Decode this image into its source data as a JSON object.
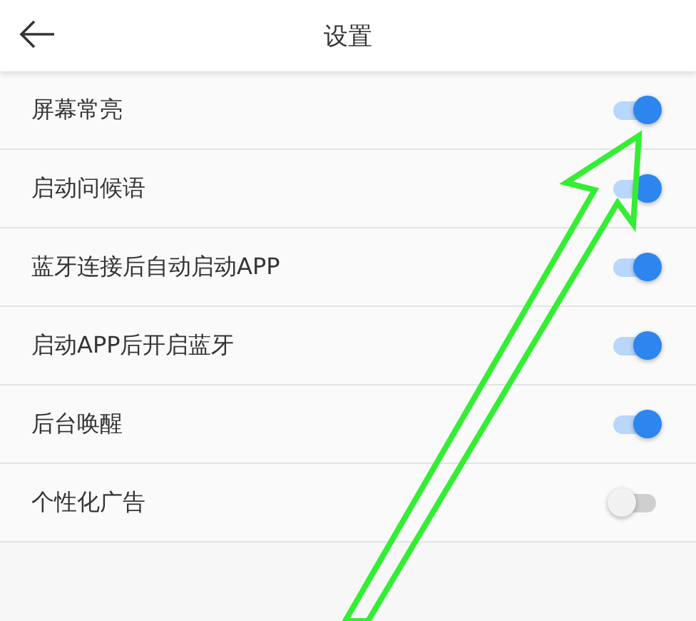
{
  "header": {
    "title": "设置"
  },
  "settings": [
    {
      "label": "屏幕常亮",
      "on": true
    },
    {
      "label": "启动问候语",
      "on": true
    },
    {
      "label": "蓝牙连接后自动启动APP",
      "on": true
    },
    {
      "label": "启动APP后开启蓝牙",
      "on": true
    },
    {
      "label": "后台唤醒",
      "on": true
    },
    {
      "label": "个性化广告",
      "on": false
    }
  ]
}
